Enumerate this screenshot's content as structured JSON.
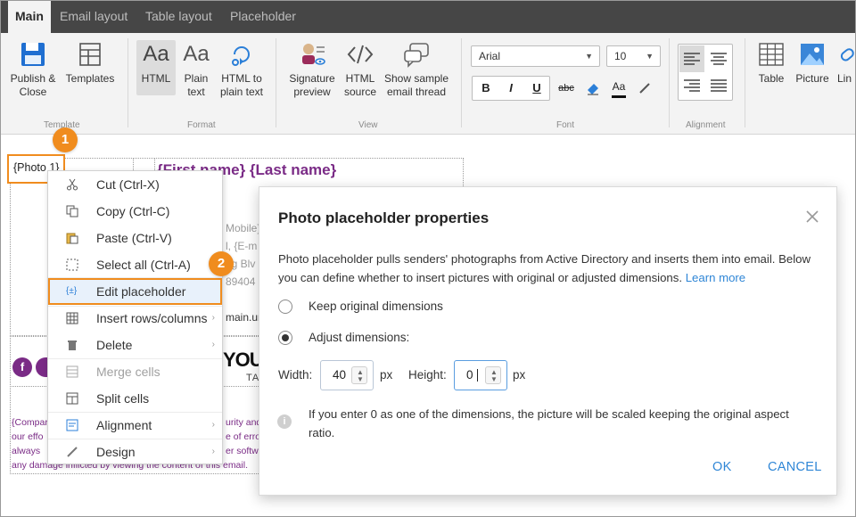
{
  "tabs": [
    {
      "label": "Main",
      "active": true
    },
    {
      "label": "Email layout",
      "active": false
    },
    {
      "label": "Table layout",
      "active": false
    },
    {
      "label": "Placeholder",
      "active": false
    }
  ],
  "ribbon": {
    "template": {
      "publish": "Publish &\nClose",
      "templates": "Templates",
      "group": "Template"
    },
    "format": {
      "html": "HTML",
      "plain": "Plain\ntext",
      "html_to_plain": "HTML to\nplain text",
      "group": "Format"
    },
    "view": {
      "sig_preview": "Signature\npreview",
      "html_source": "HTML\nsource",
      "show_thread": "Show sample\nemail thread",
      "group": "View"
    },
    "font": {
      "family": "Arial",
      "size": "10",
      "bold": "B",
      "italic": "I",
      "underline": "U",
      "strike": "abc",
      "font_color": "Aa",
      "group": "Font"
    },
    "alignment": {
      "group": "Alignment"
    },
    "insert": {
      "table": "Table",
      "picture": "Picture",
      "link": "Lin"
    }
  },
  "editor": {
    "photo_placeholder": "{Photo 1}",
    "name_placeholder": "{First name} {Last name}",
    "frag_mobile": "Mobile}",
    "frag_email": "l, {E-m",
    "frag_address": "gg Blv",
    "frag_zip": "89404",
    "frag_url": "main.url",
    "frag_you": "YOU",
    "frag_ta": "TA",
    "disclaimer_lines": [
      "{Compar",
      "our effo",
      "always",
      "any damage inflicted by viewing the content of this email."
    ],
    "disclaimer_right": [
      "urity and",
      "e of erro",
      "er softw"
    ],
    "colors": {
      "purple": "#7a2b86"
    }
  },
  "context_menu": {
    "items": [
      {
        "label": "Cut (Ctrl-X)",
        "icon": "scissors-icon",
        "disabled": false,
        "submenu": false
      },
      {
        "label": "Copy (Ctrl-C)",
        "icon": "copy-icon",
        "disabled": false,
        "submenu": false
      },
      {
        "label": "Paste (Ctrl-V)",
        "icon": "paste-icon",
        "disabled": false,
        "submenu": false
      },
      {
        "label": "Select all (Ctrl-A)",
        "icon": "select-all-icon",
        "disabled": false,
        "submenu": false
      },
      {
        "label": "Edit placeholder",
        "icon": "placeholder-icon",
        "disabled": false,
        "submenu": false,
        "selected": true
      },
      {
        "label": "Insert rows/columns",
        "icon": "grid-icon",
        "disabled": false,
        "submenu": true
      },
      {
        "label": "Delete",
        "icon": "trash-icon",
        "disabled": false,
        "submenu": true
      },
      {
        "label": "Merge cells",
        "icon": "merge-cells-icon",
        "disabled": true,
        "submenu": false
      },
      {
        "label": "Split cells",
        "icon": "split-cells-icon",
        "disabled": false,
        "submenu": false
      },
      {
        "label": "Alignment",
        "icon": "alignment-icon",
        "disabled": false,
        "submenu": true
      },
      {
        "label": "Design",
        "icon": "pencil-icon",
        "disabled": false,
        "submenu": true
      }
    ]
  },
  "callouts": {
    "one": "1",
    "two": "2"
  },
  "dialog": {
    "title": "Photo placeholder properties",
    "description": "Photo placeholder pulls senders' photographs from Active Directory and inserts them into email. Below you can define whether to insert pictures with original or adjusted dimensions.",
    "learn_more": "Learn more",
    "option_keep": "Keep original dimensions",
    "option_adjust": "Adjust dimensions:",
    "selected_option": "adjust",
    "width_label": "Width:",
    "width_value": "40",
    "height_label": "Height:",
    "height_value": "0",
    "unit": "px",
    "info": "If you enter 0 as one of the dimensions, the picture will be scaled keeping the original aspect ratio.",
    "ok": "OK",
    "cancel": "CANCEL"
  }
}
